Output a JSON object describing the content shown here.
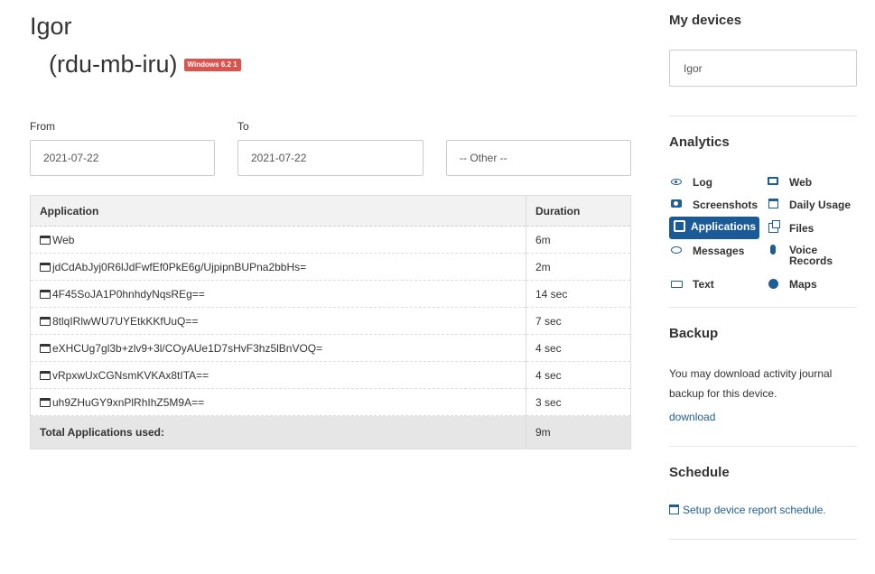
{
  "header": {
    "user_name": "Igor",
    "host_name": "(rdu-mb-iru)",
    "os_badge": "Windows 6.2 1"
  },
  "filters": {
    "from_label": "From",
    "from_value": "2021-07-22",
    "to_label": "To",
    "to_value": "2021-07-22",
    "other_value": "-- Other --"
  },
  "table": {
    "headers": [
      "Application",
      "Duration"
    ],
    "rows": [
      {
        "app": "Web",
        "duration": "6m"
      },
      {
        "app": "jdCdAbJyj0R6lJdFwfEf0PkE6g/UjpipnBUPna2bbHs=",
        "duration": "2m"
      },
      {
        "app": "4F45SoJA1P0hnhdyNqsREg==",
        "duration": "14 sec"
      },
      {
        "app": "8tlqIRlwWU7UYEtkKKfUuQ==",
        "duration": "7 sec"
      },
      {
        "app": "eXHCUg7gl3b+zlv9+3l/COyAUe1D7sHvF3hz5lBnVOQ=",
        "duration": "4 sec"
      },
      {
        "app": "vRpxwUxCGNsmKVKAx8tITA==",
        "duration": "4 sec"
      },
      {
        "app": "uh9ZHuGY9xnPlRhIhZ5M9A==",
        "duration": "3 sec"
      }
    ],
    "total_label": "Total Applications used:",
    "total_value": "9m"
  },
  "sidebar": {
    "devices_heading": "My devices",
    "device_value": "Igor",
    "analytics_heading": "Analytics",
    "nav": {
      "log": {
        "label": "Log",
        "icon": "eye-icon"
      },
      "web": {
        "label": "Web",
        "icon": "monitor-icon"
      },
      "screenshots": {
        "label": "Screenshots",
        "icon": "camera-icon"
      },
      "daily_usage": {
        "label": "Daily Usage",
        "icon": "calendar-icon"
      },
      "applications": {
        "label": "Applications",
        "icon": "puzzle-icon",
        "active": true
      },
      "files": {
        "label": "Files",
        "icon": "files-icon"
      },
      "messages": {
        "label": "Messages",
        "icon": "comment-icon"
      },
      "voice_records_1": {
        "label": "Voice",
        "icon": "microphone-icon"
      },
      "voice_records_2": {
        "label": "Records"
      },
      "text": {
        "label": "Text",
        "icon": "keyboard-icon"
      },
      "maps": {
        "label": "Maps",
        "icon": "globe-icon"
      }
    },
    "backup_heading": "Backup",
    "backup_text": "You may download activity journal backup for this device.",
    "backup_link": "download",
    "schedule_heading": "Schedule",
    "schedule_link": "Setup device report schedule."
  },
  "colors": {
    "accent": "#1a5a96",
    "badge": "#d9534f",
    "table_header_bg": "#f2f2f2",
    "table_footer_bg": "#e6e6e6"
  }
}
